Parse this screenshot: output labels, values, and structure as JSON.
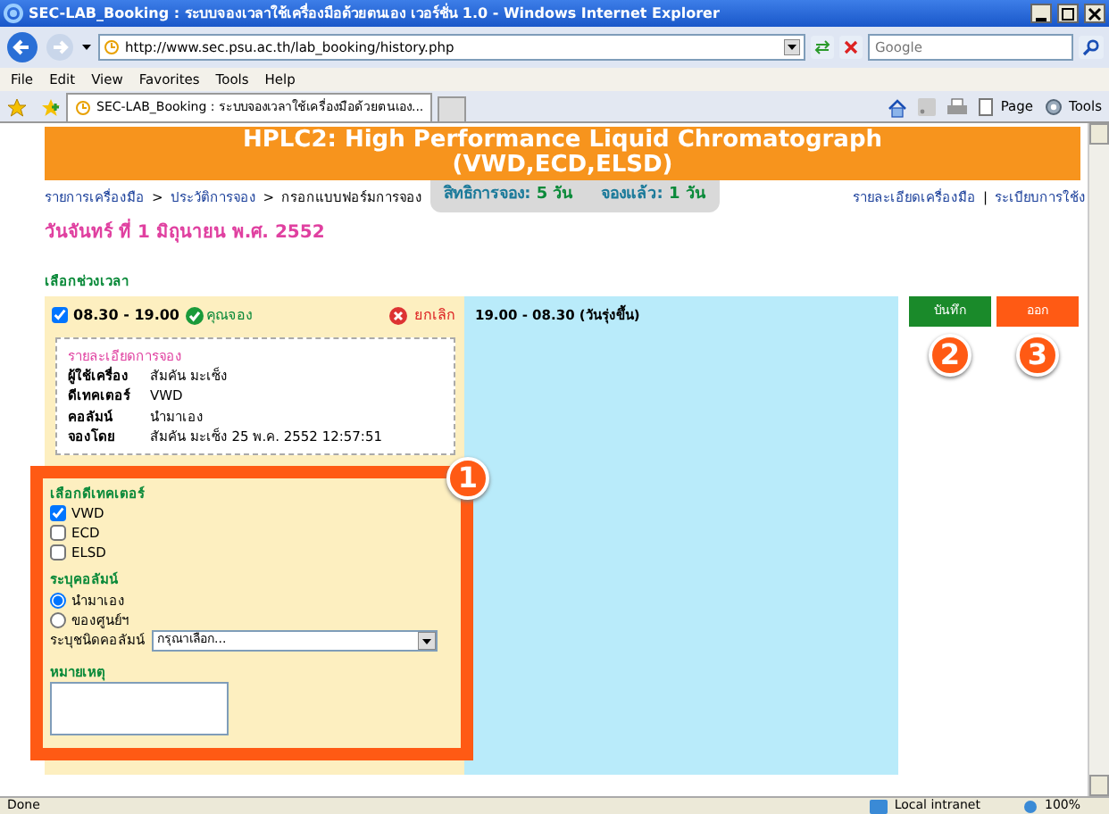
{
  "window": {
    "title": "SEC-LAB_Booking : ระบบจองเวลาใช้เครื่องมือด้วยตนเอง เวอร์ชั่น 1.0 - Windows Internet Explorer"
  },
  "address_bar": {
    "url": "http://www.sec.psu.ac.th/lab_booking/history.php"
  },
  "search": {
    "placeholder": "Google"
  },
  "menu": [
    "File",
    "Edit",
    "View",
    "Favorites",
    "Tools",
    "Help"
  ],
  "tabs": [
    {
      "label": "SEC-LAB_Booking : ระบบจองเวลาใช้เครื่องมือด้วยตนเอง...",
      "selected": true
    }
  ],
  "command_bar": [
    "Page",
    "Tools"
  ],
  "page": {
    "title_lines": [
      "HPLC2: High Performance Liquid Chromatograph",
      "(VWD,ECD,ELSD)"
    ],
    "breadcrumb": [
      {
        "label": "รายการเครื่องมือ",
        "kind": "link"
      },
      {
        "label": "ประวัติการจอง",
        "kind": "link"
      },
      {
        "label": "กรอกแบบฟอร์มการจอง",
        "kind": "current"
      }
    ],
    "breadcrumb_separator": ">",
    "quota": [
      {
        "label": "สิทธิการจอง:",
        "value": "5 วัน"
      },
      {
        "label": "จองแล้ว:",
        "value": "1 วัน"
      }
    ],
    "top_links": [
      "รายละเอียดเครื่องมือ",
      "ระเบียบการใช้ง"
    ],
    "top_links_separator": "|",
    "date": "วันจันทร์ ที่ 1 มิถุนายน พ.ศ. 2552",
    "section_label": "เลือกช่วงเวลา",
    "slots": [
      {
        "kind": "booked",
        "time": "08.30 - 19.00",
        "checked": true,
        "status": "คุณจอง",
        "action": "ยกเลิก",
        "details": {
          "title": "รายละเอียดการจอง",
          "rows": [
            [
              "ผู้ใช้เครื่อง",
              "สัมคัน มะเซ็ง"
            ],
            [
              "ดีเทคเตอร์",
              "VWD"
            ],
            [
              "คอลัมน์",
              "นำมาเอง"
            ],
            [
              "จองโดย",
              "สัมคัน มะเซ็ง 25 พ.ค. 2552 12:57:51"
            ]
          ]
        }
      },
      {
        "kind": "free",
        "time": "19.00 - 08.30 (วันรุ่งขึ้น)"
      }
    ],
    "form": {
      "callout": "1",
      "detector_label": "เลือกดีเทคเตอร์",
      "detectors": [
        {
          "label": "VWD",
          "checked": true
        },
        {
          "label": "ECD",
          "checked": false
        },
        {
          "label": "ELSD",
          "checked": false
        }
      ],
      "column_label": "ระบุคอลัมน์",
      "column_options": [
        {
          "label": "นำมาเอง",
          "selected": true
        },
        {
          "label": "ของศูนย์ฯ",
          "selected": false
        }
      ],
      "column_type": {
        "label": "ระบุชนิดคอลัมน์",
        "value": "กรุณาเลือก..."
      },
      "note_label": "หมายเหตุ"
    },
    "buttons": [
      {
        "kind": "save",
        "label": "บันทึก",
        "callout": "2"
      },
      {
        "kind": "exit",
        "label": "ออก",
        "callout": "3"
      }
    ]
  },
  "status_bar": {
    "text": "Done",
    "zone": "Local intranet",
    "zoom": "100%"
  }
}
